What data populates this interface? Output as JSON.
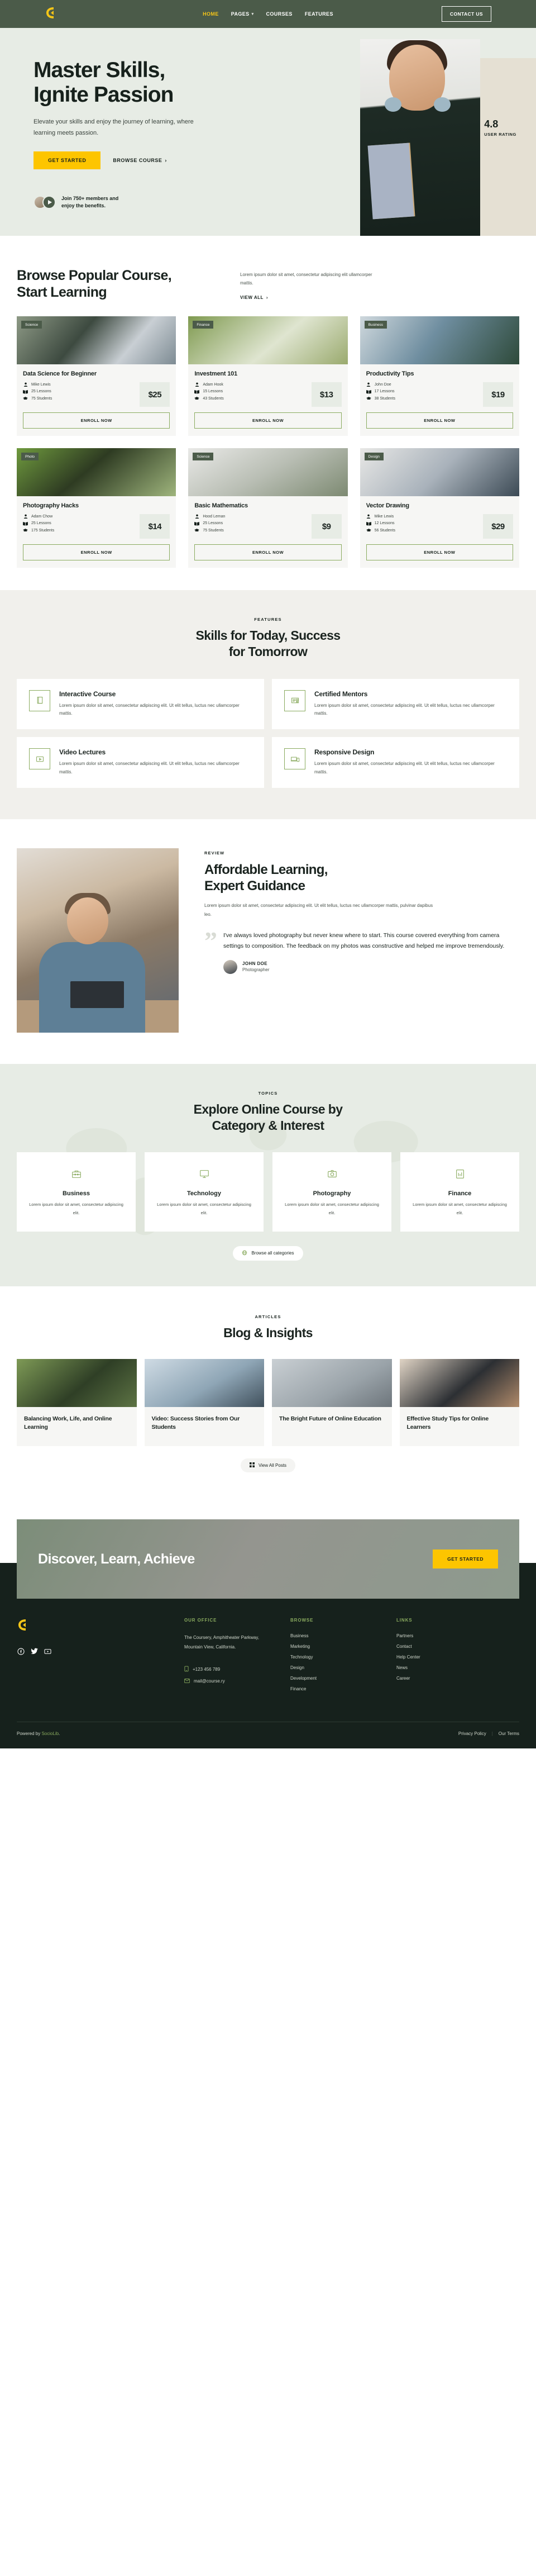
{
  "nav": {
    "logo": "coursery-logo",
    "links": [
      {
        "label": "HOME",
        "active": true,
        "caret": false
      },
      {
        "label": "PAGES",
        "active": false,
        "caret": true
      },
      {
        "label": "COURSES",
        "active": false,
        "caret": false
      },
      {
        "label": "FEATURES",
        "active": false,
        "caret": false
      }
    ],
    "cta": "CONTACT US"
  },
  "hero": {
    "title_line1": "Master Skills,",
    "title_line2": "Ignite Passion",
    "subtitle": "Elevate your skills and enjoy the journey of learning, where learning meets passion.",
    "primary_btn": "GET STARTED",
    "secondary_btn": "BROWSE COURSE",
    "secondary_arrow": "›",
    "members_line1": "Join 750+ members and",
    "members_line2": "enjoy the benefits.",
    "rating_value": "4.8",
    "rating_label": "USER RATING"
  },
  "courses": {
    "title_line1": "Browse Popular Course,",
    "title_line2": "Start Learning",
    "aside_text": "Lorem ipsum dolor sit amet, consectetur adipiscing elit ullamcorper mattis.",
    "view_all": "VIEW ALL",
    "view_all_arrow": "›",
    "enroll_label": "ENROLL NOW",
    "items": [
      {
        "tag": "Science",
        "title": "Data Science for Beginner",
        "author": "Mike Lewis",
        "lessons": "25 Lessons",
        "students": "75 Students",
        "price": "$25"
      },
      {
        "tag": "Finance",
        "title": "Investment 101",
        "author": "Adam Hook",
        "lessons": "15 Lessons",
        "students": "43 Students",
        "price": "$13"
      },
      {
        "tag": "Business",
        "title": "Productivity Tips",
        "author": "John Doe",
        "lessons": "17 Lessons",
        "students": "38 Students",
        "price": "$19"
      },
      {
        "tag": "Photo",
        "title": "Photography Hacks",
        "author": "Adam Chow",
        "lessons": "25 Lessons",
        "students": "175 Students",
        "price": "$14"
      },
      {
        "tag": "Science",
        "title": "Basic Mathematics",
        "author": "Hood Leman",
        "lessons": "25 Lessons",
        "students": "75 Students",
        "price": "$9"
      },
      {
        "tag": "Design",
        "title": "Vector Drawing",
        "author": "Mike Lewis",
        "lessons": "12 Lessons",
        "students": "56 Students",
        "price": "$29"
      }
    ]
  },
  "features": {
    "eyebrow": "FEATURES",
    "title_line1": "Skills for Today, Success",
    "title_line2": "for Tomorrow",
    "items": [
      {
        "icon": "book-icon",
        "title": "Interactive Course",
        "text": "Lorem ipsum dolor sit amet, consectetur adipiscing elit. Ut elit tellus, luctus nec ullamcorper mattis."
      },
      {
        "icon": "certificate-icon",
        "title": "Certified Mentors",
        "text": "Lorem ipsum dolor sit amet, consectetur adipiscing elit. Ut elit tellus, luctus nec ullamcorper mattis."
      },
      {
        "icon": "video-icon",
        "title": "Video Lectures",
        "text": "Lorem ipsum dolor sit amet, consectetur adipiscing elit. Ut elit tellus, luctus nec ullamcorper mattis."
      },
      {
        "icon": "devices-icon",
        "title": "Responsive Design",
        "text": "Lorem ipsum dolor sit amet, consectetur adipiscing elit. Ut elit tellus, luctus nec ullamcorper mattis."
      }
    ]
  },
  "review": {
    "eyebrow": "REVIEW",
    "title_line1": "Affordable Learning,",
    "title_line2": "Expert Guidance",
    "lead": "Lorem ipsum dolor sit amet, consectetur adipiscing elit. Ut elit tellus, luctus nec ullamcorper mattis, pulvinar dapibus leo.",
    "quote": "I've always loved photography but never knew where to start. This course covered everything from camera settings to composition. The feedback on my photos was constructive and helped me improve tremendously.",
    "author_name": "JOHN DOE",
    "author_role": "Photographer"
  },
  "topics": {
    "eyebrow": "TOPICS",
    "title_line1": "Explore Online Course by",
    "title_line2": "Category & Interest",
    "browse_all": "Browse all categories",
    "items": [
      {
        "icon": "briefcase-icon",
        "title": "Business",
        "text": "Lorem ipsum dolor sit amet, consectetur adipiscing elit."
      },
      {
        "icon": "monitor-icon",
        "title": "Technology",
        "text": "Lorem ipsum dolor sit amet, consectetur adipiscing elit."
      },
      {
        "icon": "camera-icon",
        "title": "Photography",
        "text": "Lorem ipsum dolor sit amet, consectetur adipiscing elit."
      },
      {
        "icon": "chart-icon",
        "title": "Finance",
        "text": "Lorem ipsum dolor sit amet, consectetur adipiscing elit."
      }
    ]
  },
  "blog": {
    "eyebrow": "ARTICLES",
    "title": "Blog & Insights",
    "view_all": "View All Posts",
    "items": [
      {
        "title": "Balancing Work, Life, and Online Learning"
      },
      {
        "title": "Video: Success Stories from Our Students"
      },
      {
        "title": "The Bright Future of Online Education"
      },
      {
        "title": "Effective Study Tips for Online Learners"
      }
    ]
  },
  "cta": {
    "title": "Discover, Learn, Achieve",
    "button": "GET STARTED"
  },
  "footer": {
    "office_head": "OUR OFFICE",
    "address": "The Coursery, Amphitheater Parkway, Mountain View, California.",
    "phone": "+123 456 789",
    "email": "mail@course.ry",
    "browse_head": "BROWSE",
    "browse_links": [
      "Business",
      "Marketing",
      "Technology",
      "Design",
      "Development",
      "Finance"
    ],
    "links_head": "LINKS",
    "links": [
      "Partners",
      "Contact",
      "Help Center",
      "News",
      "Career"
    ],
    "powered_prefix": "Powered by ",
    "powered_name": "SocioLib",
    "powered_suffix": ".",
    "privacy": "Privacy Policy",
    "terms": "Our Terms",
    "socials": [
      "facebook-icon",
      "twitter-icon",
      "youtube-icon"
    ]
  },
  "colors": {
    "nav_green": "#4b5b49",
    "hero_bg": "#e7ece5",
    "accent_yellow": "#fdc500",
    "accent_green": "#8aab5f",
    "dark": "#16211c"
  }
}
